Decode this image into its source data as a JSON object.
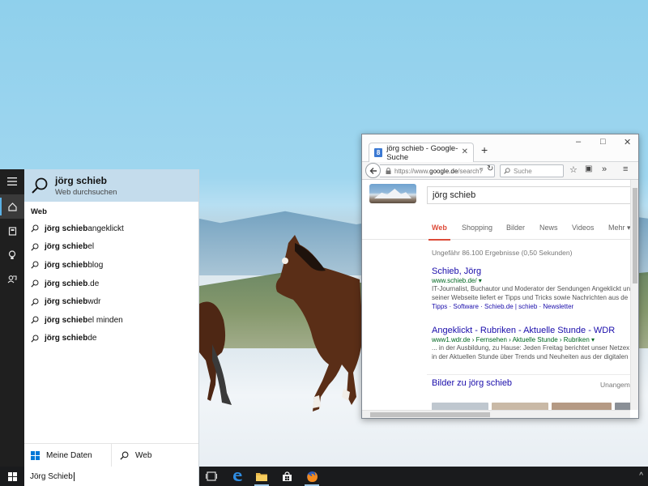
{
  "start_menu": {
    "top_result": {
      "title": "jörg schieb",
      "subtitle": "Web durchsuchen"
    },
    "web_heading": "Web",
    "suggestions": [
      {
        "query": "jörg schieb",
        "rest": " angeklickt"
      },
      {
        "query": "jörg schieb",
        "rest": "el"
      },
      {
        "query": "jörg schieb",
        "rest": " blog"
      },
      {
        "query": "jörg schieb",
        "rest": ".de"
      },
      {
        "query": "jörg schieb",
        "rest": " wdr"
      },
      {
        "query": "jörg schieb",
        "rest": "el minden"
      },
      {
        "query": "jörg schieb",
        "rest": " de"
      }
    ],
    "filters": {
      "mine": "Meine Daten",
      "web": "Web"
    },
    "rail_icons": [
      "hamburger-icon",
      "home-icon",
      "notebook-icon",
      "lightbulb-icon",
      "feedback-icon"
    ]
  },
  "taskbar": {
    "search_text": "Jörg Schieb",
    "icons": [
      "task-view-icon",
      "edge-icon",
      "file-explorer-icon",
      "store-icon",
      "firefox-icon"
    ]
  },
  "browser": {
    "tab_title": "jörg schieb - Google-Suche",
    "favicon": "8",
    "url_prefix": "https://www.",
    "url_host": "google.de",
    "url_path": "/search?",
    "search_placeholder": "Suche",
    "window_controls": {
      "minimize": "–",
      "maximize": "□",
      "close": "✕"
    },
    "google": {
      "query": "jörg schieb",
      "tabs": [
        "Web",
        "Shopping",
        "Bilder",
        "News",
        "Videos",
        "Mehr ▾"
      ],
      "active_tab": "Web",
      "stats": "Ungefähr 86.100 Ergebnisse (0,50 Sekunden)",
      "results": [
        {
          "title": "Schieb, Jörg",
          "url": "www.schieb.de/ ▾",
          "desc": [
            "IT-Journalist, Buchautor und Moderator der Sendungen Angeklickt un",
            "seiner Webseite liefert er Tipps und Tricks sowie Nachrichten aus de"
          ],
          "links": "Tipps · Software · Schieb.de | schieb · Newsletter"
        },
        {
          "title": "Angeklickt - Rubriken - Aktuelle Stunde - WDR",
          "url": "www1.wdr.de › Fernsehen › Aktuelle Stunde › Rubriken ▾",
          "desc": [
            "... in der Ausbildung, zu Hause: Jeden Freitag berichtet unser Netzex",
            "in der Aktuellen Stunde über Trends und Neuheiten aus der digitalen"
          ]
        }
      ],
      "images_heading": "Bilder zu jörg schieb",
      "images_more": "Unangeme"
    }
  },
  "colors": {
    "rail": "#1f1f1f",
    "top_result_bg": "#c4dcec",
    "taskbar": "#1a1b1d",
    "google_link": "#1a0dab",
    "google_url": "#006621",
    "google_red": "#dd4b39"
  }
}
